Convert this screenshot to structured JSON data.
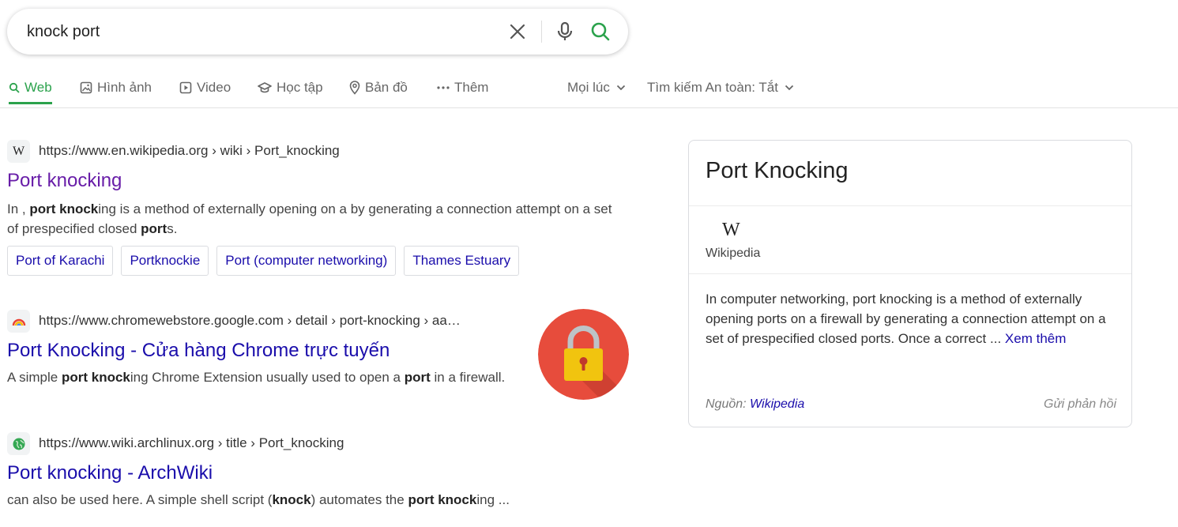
{
  "search": {
    "query": "knock port"
  },
  "tabs": [
    {
      "label": "Web",
      "active": true,
      "icon": "search-icon"
    },
    {
      "label": "Hình ảnh",
      "icon": "image-icon"
    },
    {
      "label": "Video",
      "icon": "video-icon"
    },
    {
      "label": "Học tập",
      "icon": "graduation-cap-icon"
    },
    {
      "label": "Bản đồ",
      "icon": "map-pin-icon"
    },
    {
      "label": "Thêm",
      "icon": "more-dots-icon"
    }
  ],
  "filters": {
    "time": "Mọi lúc",
    "safe_search": "Tìm kiếm An toàn: Tắt"
  },
  "results": [
    {
      "url": "https://www.en.wikipedia.org › wiki › Port_knocking",
      "title": "Port knocking",
      "snippet_parts": [
        "In , ",
        "port knock",
        "ing is a method of externally opening on a by generating a connection attempt on a set of prespecified closed ",
        "port",
        "s."
      ],
      "chips": [
        "Port of Karachi",
        "Portknockie",
        "Port (computer networking)",
        "Thames Estuary"
      ]
    },
    {
      "url": "https://www.chromewebstore.google.com › detail › port-knocking › aa…",
      "title": "Port Knocking - Cửa hàng Chrome trực tuyến",
      "snippet_parts": [
        "A simple ",
        "port knock",
        "ing Chrome Extension usually used to open a ",
        "port",
        " in a firewall."
      ]
    },
    {
      "url": "https://www.wiki.archlinux.org › title › Port_knocking",
      "title": "Port knocking - ArchWiki",
      "snippet_parts": [
        "can also be used here. A simple shell script (",
        "knock",
        ") automates the ",
        "port knock",
        "ing ..."
      ]
    }
  ],
  "knowledge_panel": {
    "title": "Port Knocking",
    "logo": "W",
    "source_name": "Wikipedia",
    "description": "In computer networking, port knocking is a method of externally opening ports on a firewall by generating a connection attempt on a set of prespecified closed ports. Once a correct ...",
    "more_link": "Xem thêm",
    "footer_source_label": "Nguồn:",
    "footer_source_link": "Wikipedia",
    "feedback": "Gửi phản hồi"
  },
  "colors": {
    "accent": "#2ba24c",
    "link": "#1a0dab",
    "visited": "#681da8"
  }
}
